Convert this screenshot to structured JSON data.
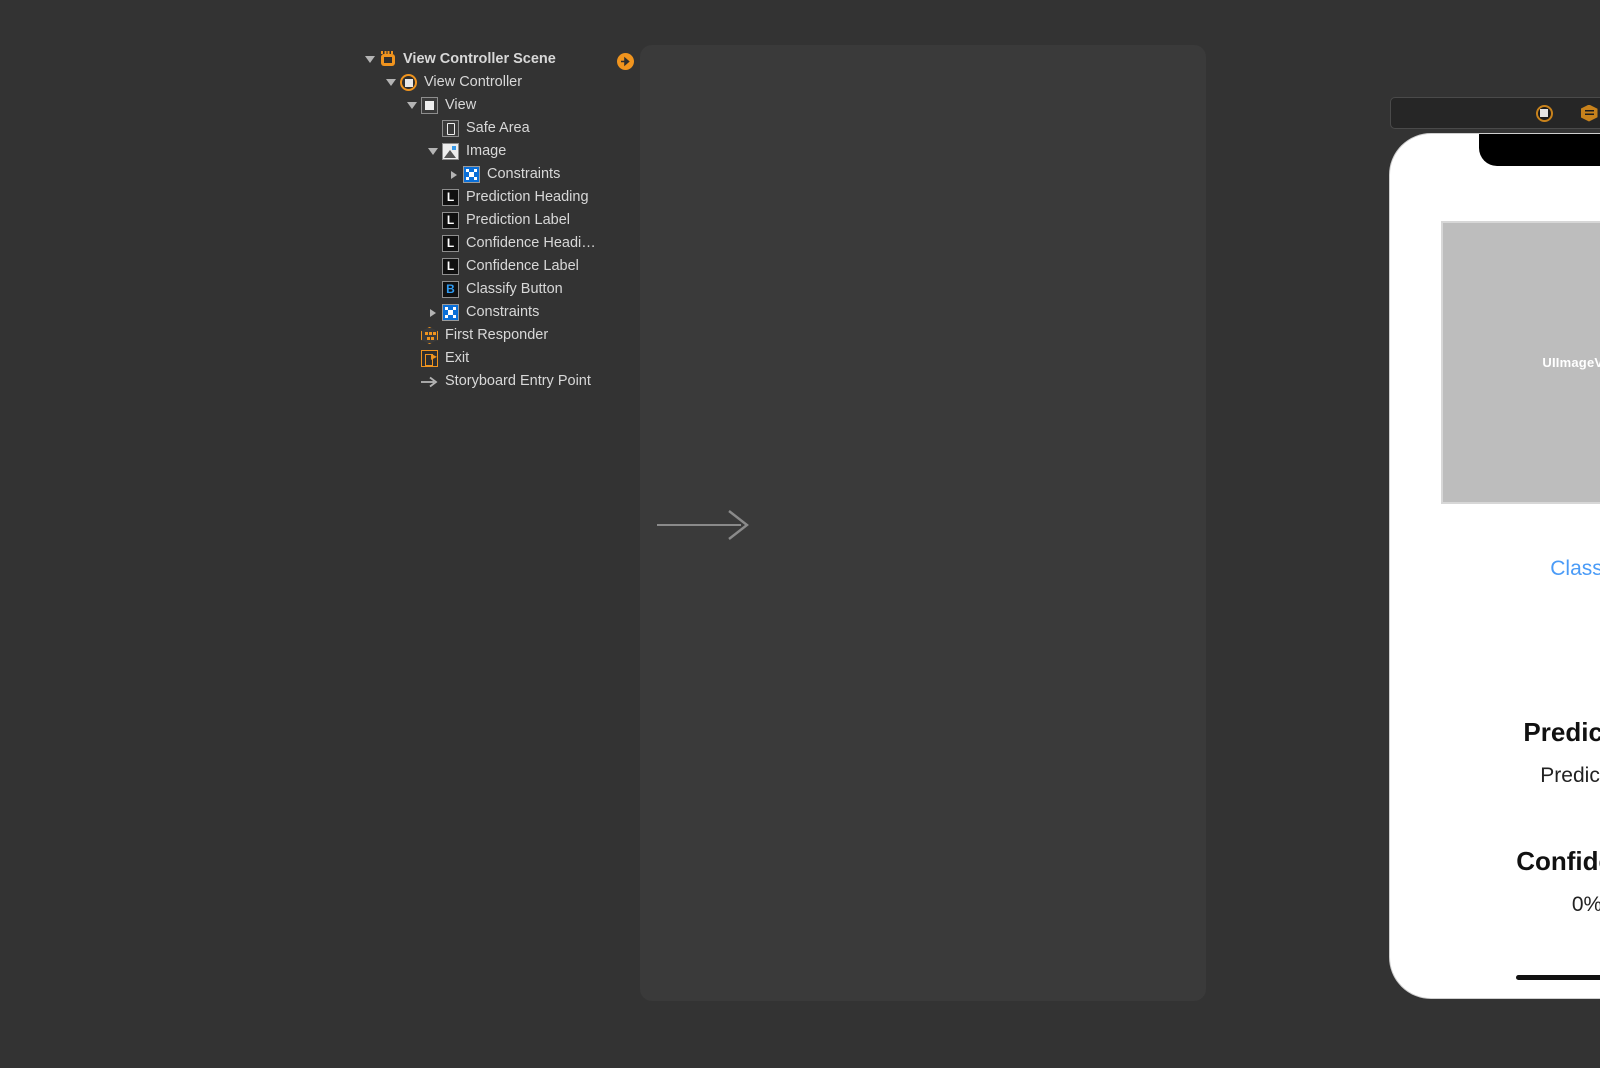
{
  "outline": {
    "entry_badge_icon": "entry-point-arrow-icon",
    "rows": [
      {
        "label": "View Controller Scene",
        "icon": "scene-icon",
        "indent": 0,
        "twisty": "open",
        "bold": true
      },
      {
        "label": "View Controller",
        "icon": "view-controller-icon",
        "indent": 1,
        "twisty": "open",
        "bold": false
      },
      {
        "label": "View",
        "icon": "view-icon",
        "indent": 2,
        "twisty": "open",
        "bold": false
      },
      {
        "label": "Safe Area",
        "icon": "safe-area-icon",
        "indent": 3,
        "twisty": "none",
        "bold": false
      },
      {
        "label": "Image",
        "icon": "image-view-icon",
        "indent": 3,
        "twisty": "open",
        "bold": false
      },
      {
        "label": "Constraints",
        "icon": "constraints-icon",
        "indent": 4,
        "twisty": "closed",
        "bold": false
      },
      {
        "label": "Prediction Heading",
        "icon": "label-icon",
        "indent": 3,
        "twisty": "none",
        "bold": false
      },
      {
        "label": "Prediction Label",
        "icon": "label-icon",
        "indent": 3,
        "twisty": "none",
        "bold": false
      },
      {
        "label": "Confidence Headi…",
        "icon": "label-icon",
        "indent": 3,
        "twisty": "none",
        "bold": false
      },
      {
        "label": "Confidence Label",
        "icon": "label-icon",
        "indent": 3,
        "twisty": "none",
        "bold": false
      },
      {
        "label": "Classify Button",
        "icon": "button-icon",
        "indent": 3,
        "twisty": "none",
        "bold": false
      },
      {
        "label": "Constraints",
        "icon": "constraints-icon",
        "indent": 3,
        "twisty": "closed",
        "bold": false
      },
      {
        "label": "First Responder",
        "icon": "first-responder-icon",
        "indent": 2,
        "twisty": "none",
        "bold": false
      },
      {
        "label": "Exit",
        "icon": "exit-icon",
        "indent": 2,
        "twisty": "none",
        "bold": false
      },
      {
        "label": "Storyboard Entry Point",
        "icon": "entry-point-arrow-icon",
        "indent": 2,
        "twisty": "none",
        "bold": false
      }
    ],
    "label_icon_glyph": "L",
    "button_icon_glyph": "B"
  },
  "canvas": {
    "device_bar": {
      "icons": [
        "view-controller-icon",
        "first-responder-icon",
        "exit-icon"
      ]
    },
    "entry_arrow_icon": "storyboard-entry-arrow-icon",
    "phone": {
      "image_view_placeholder": "UIImageView",
      "classify_button": "Classify",
      "prediction_heading": "Prediction",
      "prediction_label": "Prediction",
      "confidence_heading": "Confidence",
      "confidence_label": "0%"
    }
  },
  "colors": {
    "background": "#333333",
    "canvas": "#3a3a3a",
    "accent_orange": "#f0941e",
    "accent_blue": "#0a6fd8",
    "button_blue": "#4a9bf7",
    "placeholder_gray": "#bdbdbd",
    "text": "#d8d8d8"
  }
}
